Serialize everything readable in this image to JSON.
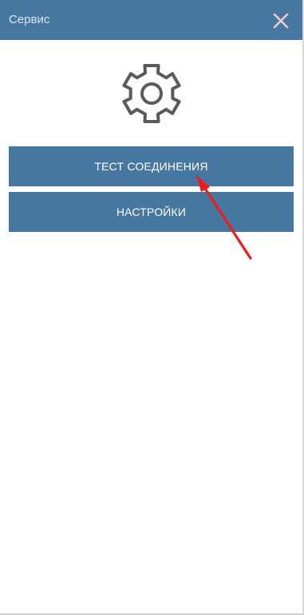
{
  "header": {
    "title": "Сервис",
    "close_icon": "close-icon"
  },
  "main": {
    "icon": "gear-icon",
    "buttons": [
      {
        "label": "ТЕСТ СОЕДИНЕНИЯ"
      },
      {
        "label": "НАСТРОЙКИ"
      }
    ]
  },
  "annotation": {
    "icon": "arrow-icon",
    "color": "#f01a1a"
  },
  "colors": {
    "primary": "#4677a1",
    "header_text": "#dbe6f0",
    "gear": "#5a5a5a",
    "close": "#f3c7d4"
  }
}
